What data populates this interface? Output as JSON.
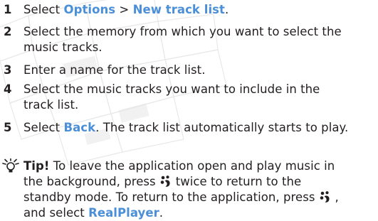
{
  "steps": [
    {
      "num": "1",
      "prefix": "Select ",
      "cmd1": "Options",
      "sep": " > ",
      "cmd2": "New track list",
      "suffix": "."
    },
    {
      "num": "2",
      "line1": "Select the memory from which you want to select the",
      "line2": "music tracks."
    },
    {
      "num": "3",
      "line1": "Enter a name for the track list."
    },
    {
      "num": "4",
      "line1": "Select the music tracks you want to include in the",
      "line2": "track list."
    },
    {
      "num": "5",
      "prefix": "Select ",
      "cmd": "Back",
      "suffix": ". The track list automatically starts to play."
    }
  ],
  "tip": {
    "label": "Tip!",
    "line1_rest": " To leave the application open and play music in",
    "line2_a": "the background, press",
    "line2_b": "twice to return to the",
    "line3_a": "standby mode. To return to the application, press",
    "line3_b": ",",
    "line4_a": "and select ",
    "line4_cmd": "RealPlayer",
    "line4_b": ".",
    "icon": "lightbulb-icon",
    "key_icon": "menu-key-icon"
  },
  "colors": {
    "command": "#4a8fd8",
    "text": "#231f20",
    "watermark": "#c8c8c8"
  }
}
